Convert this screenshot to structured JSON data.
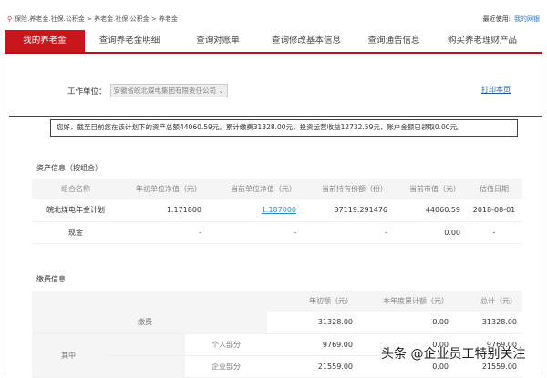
{
  "breadcrumb": [
    "保险.养老金.社保.公积金",
    "养老金.社保.公积金",
    "养老金"
  ],
  "recent": {
    "label": "最近使用:",
    "link": "我的网银"
  },
  "tabs": [
    "我的养老金",
    "查询养老金明细",
    "查询对账单",
    "查询修改基本信息",
    "查询通告信息",
    "购买养老理财产品"
  ],
  "work_unit": {
    "label": "工作单位：",
    "value": "安徽省皖北煤电集团有限责任公司"
  },
  "print_label": "打印本页",
  "notice": "您好，截至目前您在该计划下的资产总额44060.59元。累计缴费31328.00元，投资运营收益12732.59元，账户金额已领取0.00元。",
  "assets": {
    "title": "资产信息（按组合）",
    "headers": [
      "组合名称",
      "年初单位净值（元）",
      "当前单位净值（元）",
      "当前持有份额（份）",
      "当前市值（元）",
      "估值日期"
    ],
    "rows": [
      [
        "皖北煤电年金计划",
        "1.171800",
        "1.187000",
        "37119.291476",
        "44060.59",
        "2018-08-01"
      ],
      [
        "现金",
        "-",
        "-",
        "-",
        "0.00",
        "-"
      ]
    ]
  },
  "payments": {
    "title": "缴费信息",
    "headers": [
      "年初额（元）",
      "本年度累计额（元）",
      "总计（元）"
    ],
    "total_label": "缴费",
    "of_which": "其中",
    "rows": [
      [
        "31328.00",
        "0.00",
        "31328.00"
      ]
    ],
    "personal": {
      "label": "个人部分",
      "values": [
        "9769.00",
        "0.00",
        "9769.00"
      ]
    },
    "company": {
      "label": "企业部分",
      "values": [
        "21559.00",
        "0.00",
        "21559.00"
      ]
    }
  },
  "watermark": "头条 @企业员工特别关注"
}
